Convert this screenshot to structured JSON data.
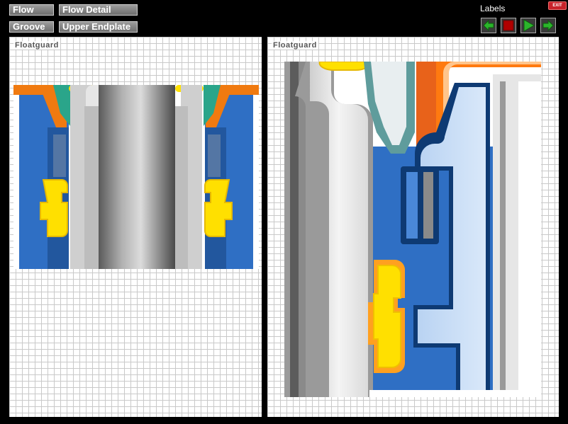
{
  "toolbar": {
    "flow_label": "Flow",
    "flow_detail_label": "Flow Detail",
    "groove_label": "Groove",
    "upper_endplate_label": "Upper Endplate"
  },
  "labels_title": "Labels",
  "exit_label": "EXIT",
  "controls": {
    "prev_icon": "green-left-arrow",
    "stop_icon": "red-stop-square",
    "play_icon": "green-play-triangle",
    "next_icon": "green-right-arrow"
  },
  "panels": {
    "left_label": "Floatguard",
    "right_label": "Floatguard"
  },
  "colors": {
    "background": "#000000",
    "button_fill": "#858585",
    "exit_red": "#c8222a",
    "control_green": "#2bb52b",
    "control_red": "#b00000",
    "housing_blue": "#2f6fc4",
    "seal_yellow": "#ffe000",
    "seal_orange": "#f07a10",
    "seal_teal": "#2aa58a",
    "pale_blue": "#c5dcf5"
  }
}
